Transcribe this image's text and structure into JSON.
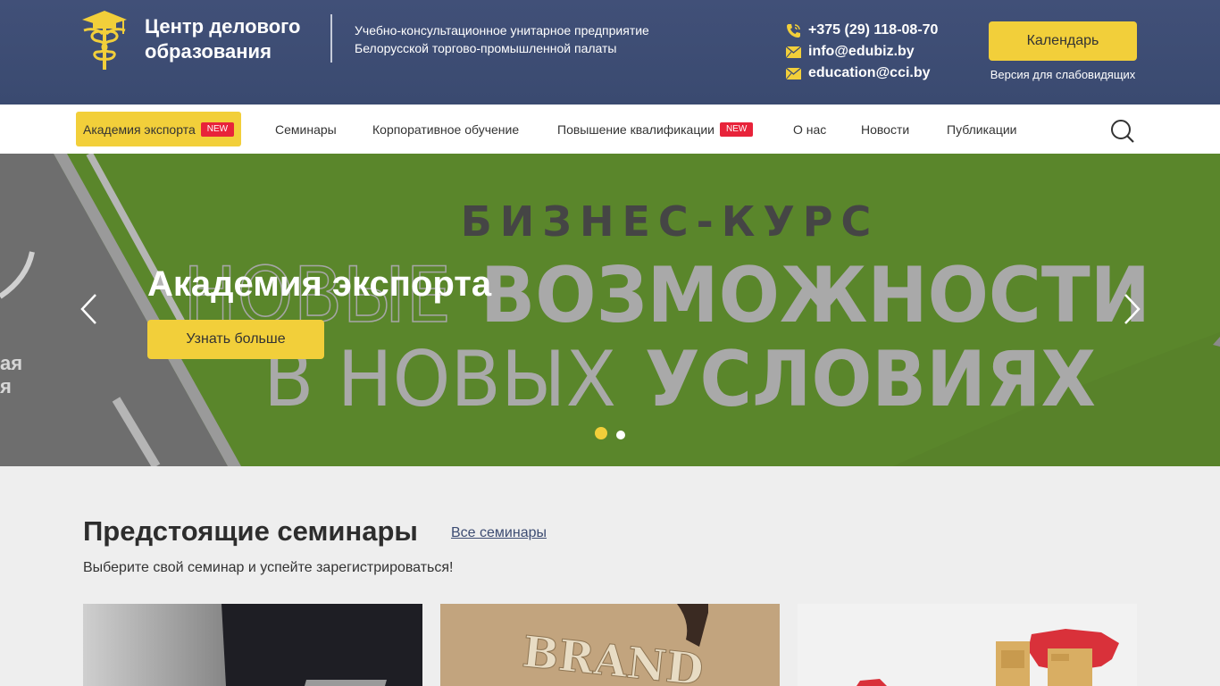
{
  "header": {
    "logo_title": "Центр делового образования",
    "org_line1": "Учебно-консультационное унитарное предприятие",
    "org_line2": "Белорусской торгово-промышленной палаты",
    "phone": "+375 (29) 118-08-70",
    "email1": "info@edubiz.by",
    "email2": "education@cci.by",
    "calendar_label": "Календарь",
    "low_vision_label": "Версия для слабовидящих"
  },
  "nav": {
    "items": [
      {
        "label": "Академия экспорта",
        "badge": "NEW"
      },
      {
        "label": "Семинары"
      },
      {
        "label": "Корпоративное обучение"
      },
      {
        "label": "Повышение квалификации",
        "badge": "NEW"
      },
      {
        "label": "О нас"
      },
      {
        "label": "Новости"
      },
      {
        "label": "Публикации"
      }
    ]
  },
  "hero": {
    "banner_line1": "БИЗНЕС-КУРС",
    "banner_line2a": "НОВЫЕ",
    "banner_line2b": "ВОЗМОЖНОСТИ",
    "banner_line3a": "В НОВЫХ",
    "banner_line3b": "УСЛОВИЯХ",
    "title": "Академия экспорта",
    "button_label": "Узнать больше",
    "slides_total": 2,
    "active_slide": 1
  },
  "seminars": {
    "title": "Предстоящие семинары",
    "all_link": "Все семинары",
    "subtitle": "Выберите свой семинар и успейте зарегистрироваться!",
    "card2_image_text": "BRAND"
  },
  "colors": {
    "header_bg": "#3d4c72",
    "accent_yellow": "#f2cf3a",
    "badge_red": "#e8233a",
    "hero_green": "#5a862b"
  }
}
